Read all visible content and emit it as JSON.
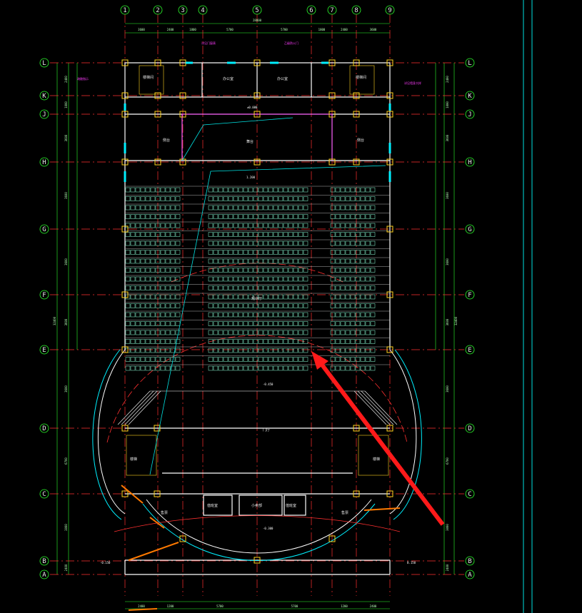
{
  "colors": {
    "background": "#000000",
    "axis_line": "#ff3030",
    "wall": "#ffffff",
    "dimension": "#2cff2c",
    "seat": "#8cffd8",
    "column": "#ffd21e",
    "annotation": "#ff40ff",
    "window": "#00f0ff",
    "arrow": "#ff1a1a",
    "frame": "#00e0e0"
  },
  "column_axes": [
    "1",
    "2",
    "3",
    "4",
    "5",
    "6",
    "7",
    "8",
    "9"
  ],
  "row_axes": [
    "L",
    "K",
    "J",
    "H",
    "G",
    "F",
    "E",
    "D",
    "C",
    "B",
    "A"
  ],
  "top_total_dimension": "28800",
  "top_dimensions": [
    "3600",
    "2400",
    "1800",
    "5700",
    "5700",
    "1800",
    "2400",
    "3600"
  ],
  "bottom_dimensions": [
    "2400",
    "1200",
    "5700",
    "5700",
    "1200",
    "2400"
  ],
  "left_total_dimension": "32400",
  "right_total_dimension": "32400",
  "left_dimensions": [
    "2400",
    "1000",
    "3600",
    "3600",
    "3600",
    "3600",
    "3600",
    "6700",
    "3000",
    "2400",
    "1600"
  ],
  "right_dimensions": [
    "2400",
    "1000",
    "3600",
    "3600",
    "3600",
    "3600",
    "3600",
    "6700",
    "3000",
    "2400",
    "1600"
  ],
  "rooms": [
    {
      "name": "楼梯间",
      "key": "stair-nw"
    },
    {
      "name": "办公室",
      "key": "office-1"
    },
    {
      "name": "办公室",
      "key": "office-2"
    },
    {
      "name": "楼梯间",
      "key": "stair-ne"
    },
    {
      "name": "舞台",
      "key": "stage"
    },
    {
      "name": "侧台",
      "key": "side-left"
    },
    {
      "name": "侧台",
      "key": "side-right"
    },
    {
      "name": "观众厅",
      "key": "hall"
    },
    {
      "name": "门厅",
      "key": "foyer"
    },
    {
      "name": "值班室",
      "key": "duty-1"
    },
    {
      "name": "小卖部",
      "key": "kiosk"
    },
    {
      "name": "值班室",
      "key": "duty-2"
    },
    {
      "name": "售票",
      "key": "ticket-left"
    },
    {
      "name": "售票",
      "key": "ticket-right"
    },
    {
      "name": "楼梯",
      "key": "stair-sw"
    },
    {
      "name": "楼梯",
      "key": "stair-se"
    }
  ],
  "elevations": [
    "±0.000",
    "1.200",
    "-0.450",
    "-0.300",
    "-0.150",
    "0.150"
  ],
  "annotations": [
    "详见门窗表",
    "乙级防火门",
    "疏散指示",
    "详见墙身大样"
  ]
}
